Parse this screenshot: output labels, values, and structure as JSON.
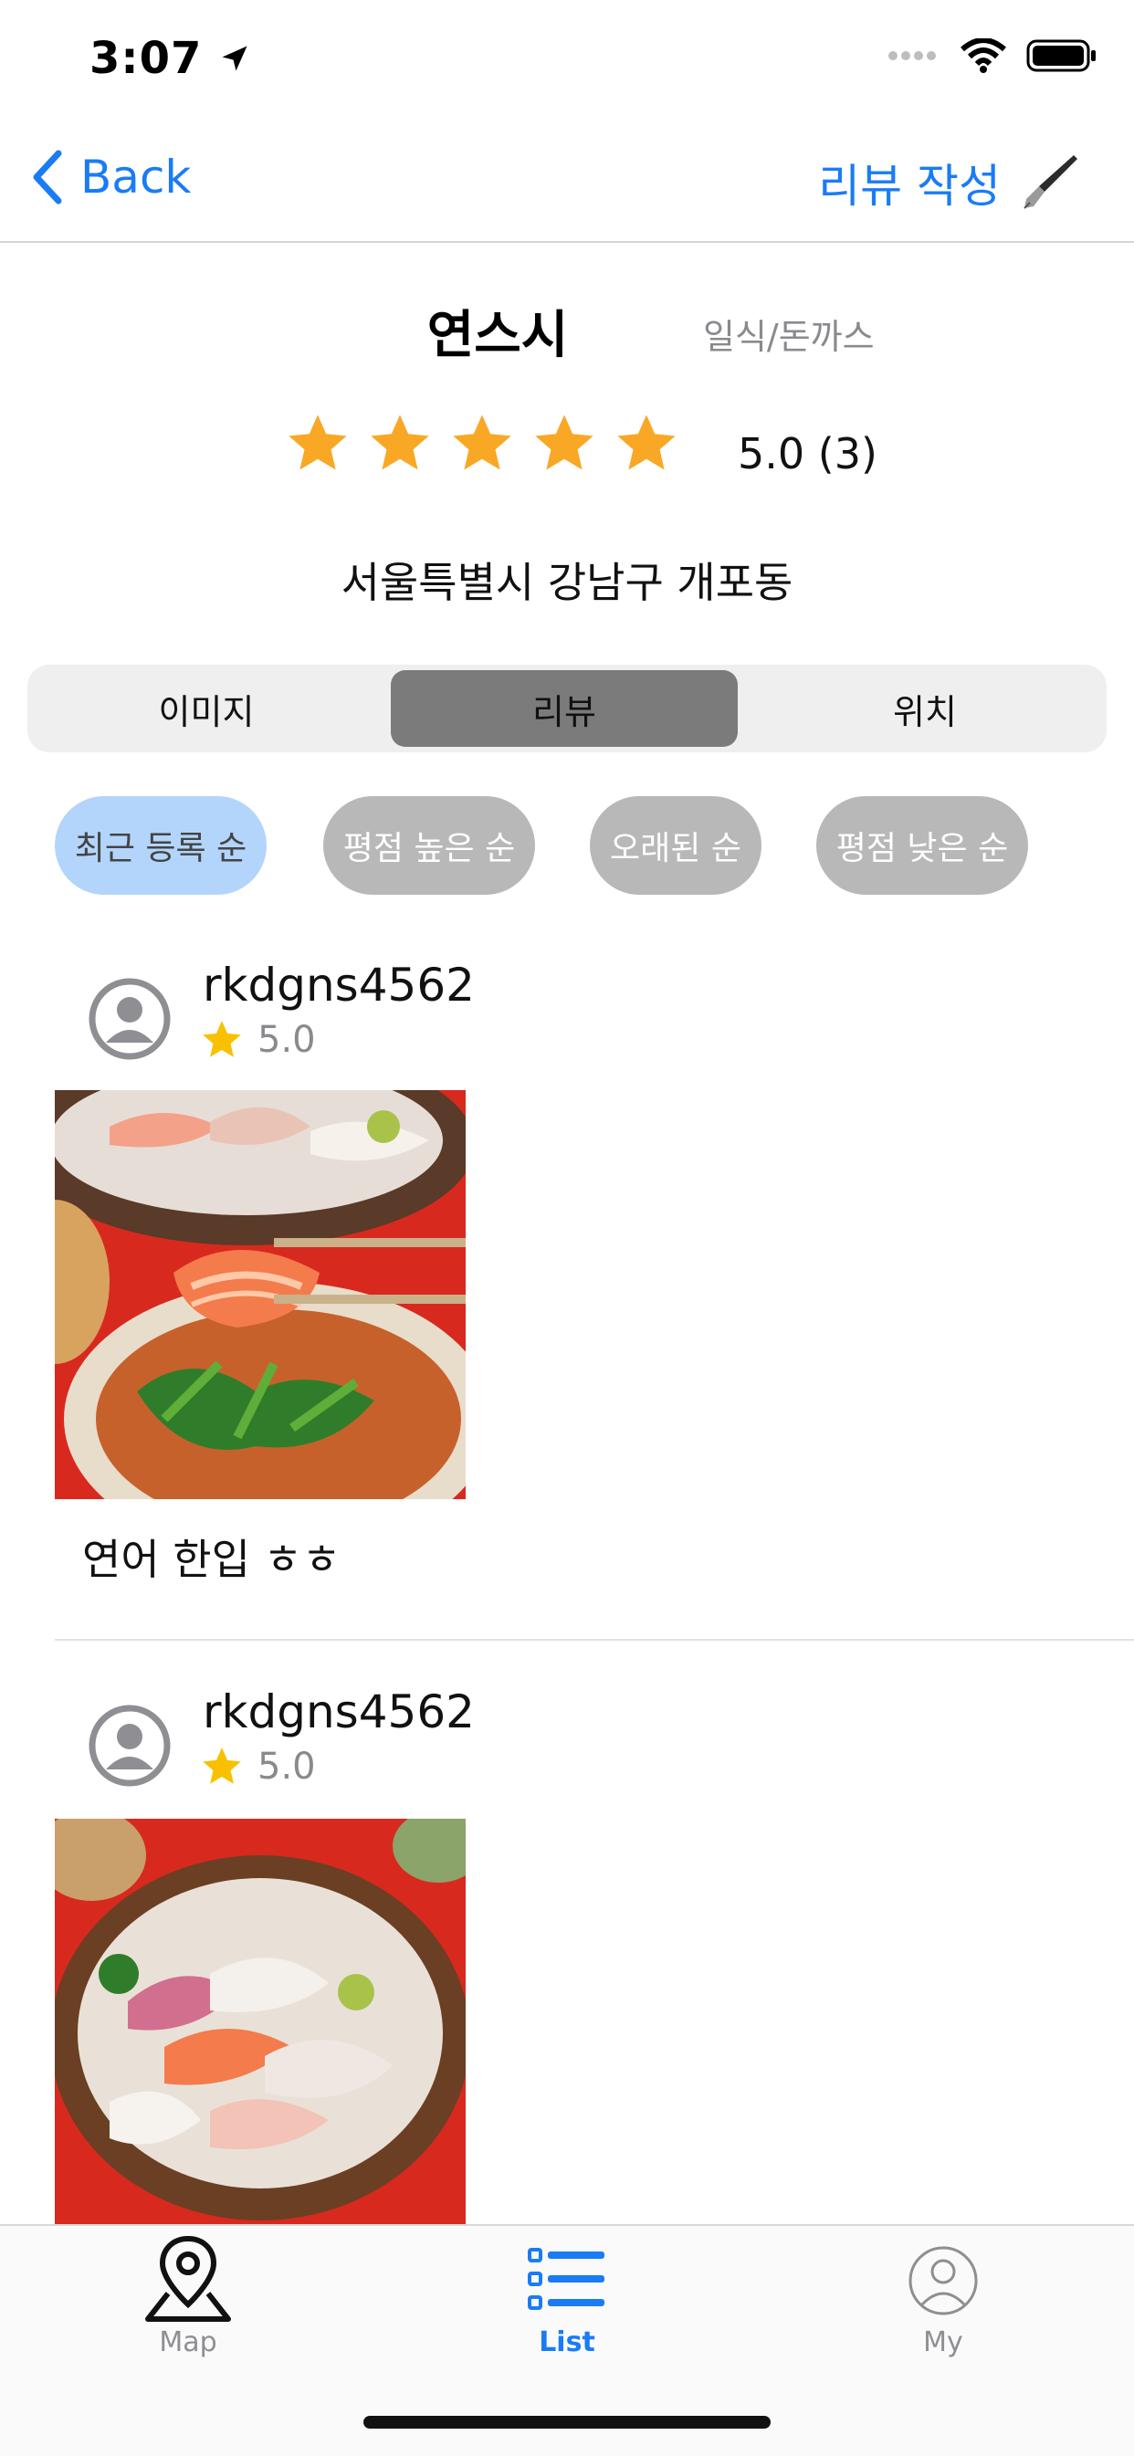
{
  "status": {
    "time": "3:07"
  },
  "nav": {
    "back_label": "Back",
    "write_label": "리뷰 작성"
  },
  "store": {
    "name": "연스시",
    "category": "일식/돈까스",
    "rating_text": "5.0 (3)",
    "rating_value": 5.0,
    "address": "서울특별시 강남구 개포동"
  },
  "segments": [
    {
      "label": "이미지"
    },
    {
      "label": "리뷰"
    },
    {
      "label": "위치"
    }
  ],
  "active_segment": "리뷰",
  "sort_chips": [
    {
      "label": "최근 등록 순"
    },
    {
      "label": "평점 높은 순"
    },
    {
      "label": "오래된 순"
    },
    {
      "label": "평점 낮은 순"
    }
  ],
  "active_sort": "최근 등록 순",
  "reviews": [
    {
      "user": "rkdgns4562",
      "rating": "5.0",
      "text": "연어 한입 ㅎㅎ"
    },
    {
      "user": "rkdgns4562",
      "rating": "5.0",
      "text": ""
    }
  ],
  "tabbar": [
    {
      "label": "Map",
      "icon": "map-pin-icon"
    },
    {
      "label": "List",
      "icon": "list-icon"
    },
    {
      "label": "My",
      "icon": "person-circle-icon"
    }
  ],
  "active_tab": "List",
  "colors": {
    "accent": "#1a7cf5",
    "star": "#f9a825",
    "chip_active": "#b3d5fb",
    "chip_inactive": "#b8b8b8",
    "segment_active": "#7b7b7b"
  }
}
